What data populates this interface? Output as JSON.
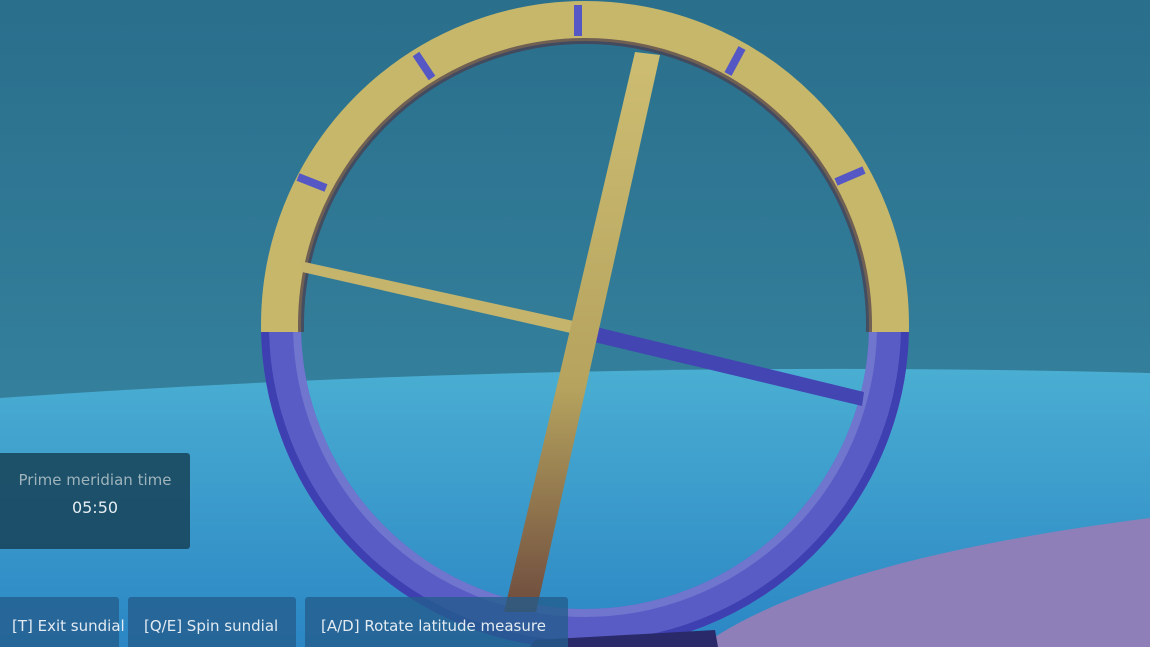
{
  "hud": {
    "time_label": "Prime meridian time",
    "time_value": "05:50"
  },
  "hints": {
    "exit": "[T] Exit sundial",
    "spin": "[Q/E] Spin sundial",
    "rotate": "[A/D] Rotate latitude measure"
  },
  "colors": {
    "sky": "#2e7a97",
    "sea": "#3a9fcb",
    "ground": "#8e7fb8",
    "ring_sunlit": "#c9b96a",
    "ring_shadow": "#4a4fb8",
    "ring_marker": "#5a5cc4"
  },
  "icons": [
    "sundial-ring"
  ]
}
